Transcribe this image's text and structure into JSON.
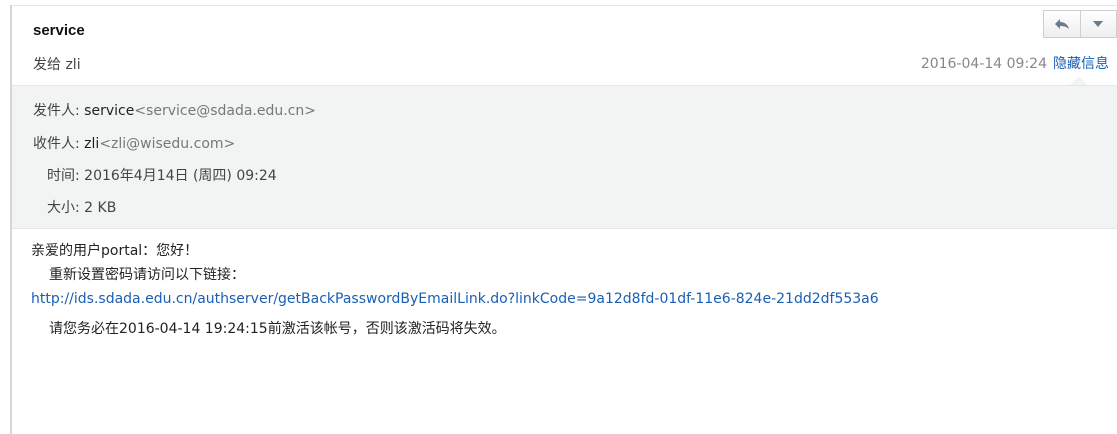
{
  "email": {
    "subject": "service",
    "sent_to": "发给 zli",
    "date": "2016-04-14 09:24",
    "toggle_label": "隐藏信息",
    "details": {
      "from_label": "发件人:",
      "from_name": "service",
      "from_address": "<service@sdada.edu.cn>",
      "to_label": "收件人:",
      "to_name": "zli",
      "to_address": "<zli@wisedu.com>",
      "time_label": "时间:",
      "time_value": "2016年4月14日 (周四) 09:24",
      "size_label": "大小:",
      "size_value": "2 KB"
    },
    "body": {
      "greeting": "亲爱的用户portal：您好！",
      "instruction": "重新设置密码请访问以下链接：",
      "reset_link": "http://ids.sdada.edu.cn/authserver/getBackPasswordByEmailLink.do?linkCode=9a12d8fd-01df-11e6-824e-21dd2df553a6",
      "expiry_note": "请您务必在2016-04-14 19:24:15前激活该帐号，否则该激活码将失效。"
    }
  },
  "toolbar": {
    "reply_icon": "reply-icon",
    "more_icon": "chevron-down-icon"
  },
  "colors": {
    "link": "#1a5fb4",
    "details_bg": "#f2f3f3",
    "date": "#888888"
  }
}
